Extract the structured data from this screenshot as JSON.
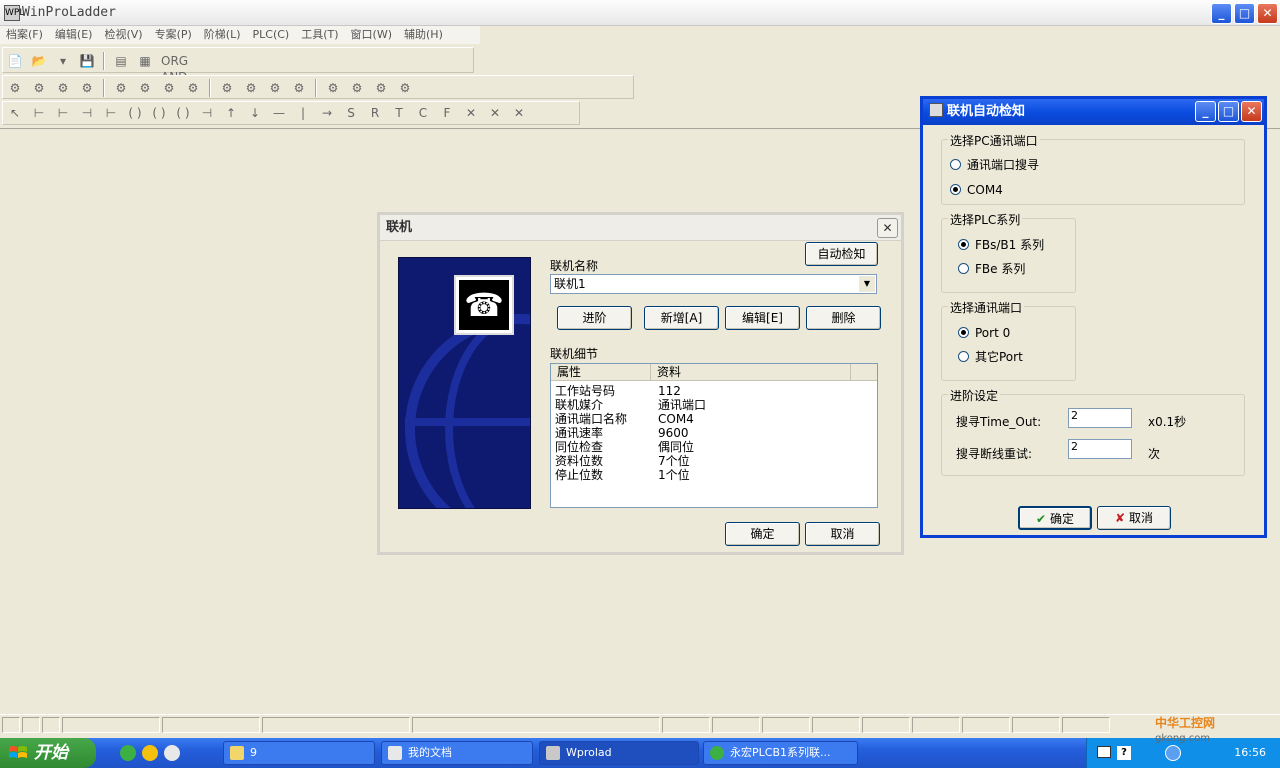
{
  "app": {
    "title": "WinProLadder",
    "icon": "WPL"
  },
  "window_controls": {
    "minimize": "_",
    "maximize": "□",
    "close": "✕"
  },
  "menu": [
    "档案(F)",
    "编辑(E)",
    "检视(V)",
    "专案(P)",
    "阶梯(L)",
    "PLC(C)",
    "工具(T)",
    "窗口(W)",
    "辅助(H)"
  ],
  "toolbar1": {
    "icons": [
      "📄",
      "📂",
      "▾",
      "💾",
      "▤",
      "▦",
      "ORG AND"
    ]
  },
  "toolbar2": {
    "icons": [
      "⚙",
      "⚙",
      "⚙",
      "⚙",
      "⚙",
      "⚙",
      "⚙",
      "⚙",
      "⚙",
      "⚙",
      "⚙",
      "⚙",
      "⚙",
      "⚙",
      "⚙",
      "⚙"
    ]
  },
  "toolbar3": {
    "icons": [
      "↖",
      "⊢",
      "⊢",
      "⊣",
      "⊢",
      "( )",
      "( )",
      "( )",
      "⊣",
      "↑",
      "↓",
      "—",
      "|",
      "→",
      "S",
      "R",
      "T",
      "C",
      "F",
      "✕",
      "✕",
      "✕"
    ]
  },
  "connection_dialog": {
    "title": "联机",
    "close": "✕",
    "auto_detect": "自动检知",
    "name_label": "联机名称",
    "name_value": "联机1",
    "buttons": {
      "advanced": "进阶",
      "add": "新增[A]",
      "edit": "编辑[E]",
      "delete": "删除"
    },
    "details_label": "联机细节",
    "columns": [
      "属性",
      "资料"
    ],
    "rows": [
      [
        "工作站号码",
        "112"
      ],
      [
        "联机媒介",
        "通讯端口"
      ],
      [
        "通讯端口名称",
        "COM4"
      ],
      [
        "通讯速率",
        "9600"
      ],
      [
        "同位检查",
        "偶同位"
      ],
      [
        "资料位数",
        "7个位"
      ],
      [
        "停止位数",
        "1个位"
      ]
    ],
    "ok": "确定",
    "cancel": "取消"
  },
  "auto_dialog": {
    "title": "联机自动检知",
    "pc_group": "选择PC通讯端口",
    "pc_options": [
      "通讯端口搜寻",
      "COM4"
    ],
    "pc_selected": 1,
    "plc_group": "选择PLC系列",
    "plc_options": [
      "FBs/B1 系列",
      "FBe 系列"
    ],
    "port_group": "选择通讯端口",
    "port_options": [
      "Port 0",
      "其它Port"
    ],
    "advanced_group": "进阶设定",
    "timeout_label": "搜寻Time_Out:",
    "timeout_value": "2",
    "timeout_unit": "x0.1秒",
    "retry_label": "搜寻断线重试:",
    "retry_value": "2",
    "retry_unit": "次",
    "ok": "确定",
    "cancel": "取消"
  },
  "taskbar": {
    "start": "开始",
    "tasks": [
      "9",
      "我的文档",
      "Wprolad",
      "永宏PLCB1系列联..."
    ],
    "clock": "16:56"
  },
  "watermark": {
    "line1": "中华工控网",
    "line2": "gkong.com"
  }
}
